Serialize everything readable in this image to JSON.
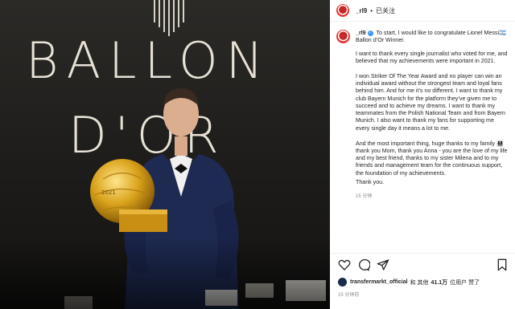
{
  "post": {
    "username": "_rl9",
    "follow_state": "已关注",
    "caption_first": "To start, I would like to congratulate Lionel Messi🇦🇷 Ballon d’Or Winner.",
    "paragraphs": [
      "I want to thank every single journalist who voted for me, and believed that my achievements were important in 2021.",
      "I won Striker Of The Year Award and no player can win an individual award without the strongest team and loyal fans behind him. And for me it’s no different. I want to thank my club Bayern Munich for the platform they’ve given me to succeed and to achieve my dreams. I want to thank my teammates from the Polish National Team and from Bayern Munich. I also want to thank my fans for supporting me every single day it means a lot to me.",
      "And the most important thing, huge thanks to my family 👨‍👩‍👧‍👧 thank you Mom, thank you Anna - you are the love of my life and my best friend, thanks to my sister Milena and to my friends and management team for the continuous support, the foundation of my achievements.",
      "Thank you."
    ],
    "caption_time": "15 分钟"
  },
  "likes": {
    "user": "transfermarkt_official",
    "middle": "和 其他",
    "count": "41.1万",
    "suffix": "位用户 赞了"
  },
  "timestamp": "15 分钟前",
  "photo": {
    "line1": "BALLON",
    "line2": "D'OR",
    "trophy_year": "2021"
  },
  "icons": [
    "heart-icon",
    "comment-icon",
    "share-icon",
    "bookmark-icon"
  ],
  "colors": {
    "verified": "#3897f0",
    "text": "#262626",
    "muted": "#8e8e8e"
  }
}
